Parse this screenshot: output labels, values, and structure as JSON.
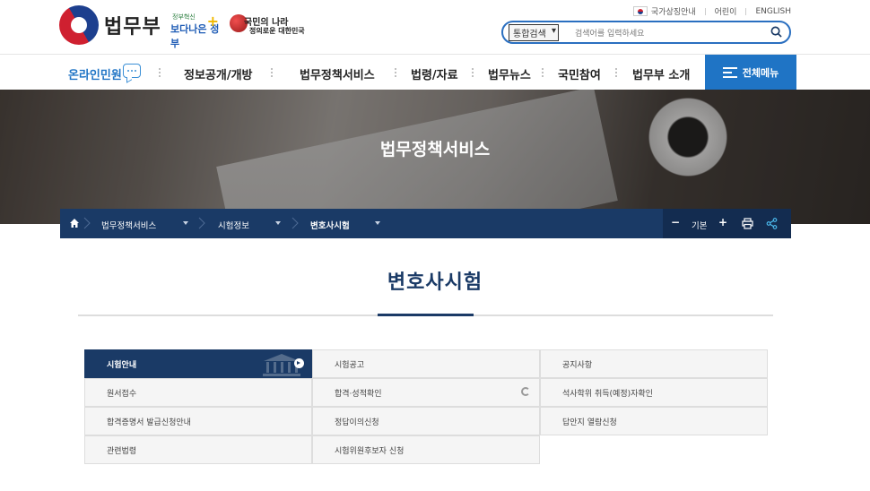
{
  "header": {
    "logo_text": "법무부",
    "slogan1_small": "정부혁신",
    "slogan1_main": "보다나은 정부",
    "slogan2_line1": "국민의 나라",
    "slogan2_line2": "정의로운 대한민국",
    "utility": [
      "국가상징안내",
      "어린이",
      "ENGLISH"
    ],
    "search": {
      "scope": "통합검색",
      "placeholder": "검색어를 입력하세요"
    }
  },
  "gnb": {
    "items": [
      "온라인민원",
      "정보공개/개방",
      "법무정책서비스",
      "법령/자료",
      "법무뉴스",
      "국민참여",
      "법무부 소개"
    ],
    "all_menu": "전체메뉴"
  },
  "banner": {
    "title": "법무정책서비스"
  },
  "breadcrumb": {
    "items": [
      "법무정책서비스",
      "시험정보",
      "변호사시험"
    ],
    "font_controls": {
      "minus": "−",
      "default": "기본",
      "plus": "+"
    }
  },
  "page": {
    "title": "변호사시험"
  },
  "submenu": {
    "items": [
      "시험안내",
      "시험공고",
      "공지사항",
      "원서접수",
      "합격·성적확인",
      "석사학위 취득(예정)자확인",
      "합격증명서 발급신청안내",
      "정답이의신청",
      "답안지 열람신청",
      "관련법령",
      "시험위원후보자 신청"
    ]
  },
  "colors": {
    "primary_navy": "#1a3a66",
    "accent_blue": "#1f74c5"
  }
}
